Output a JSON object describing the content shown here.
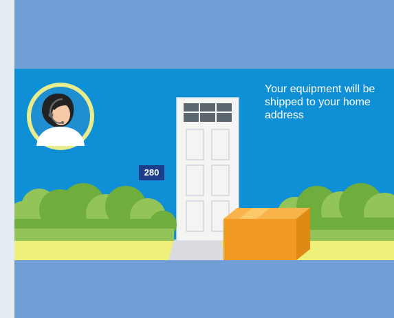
{
  "banner": {
    "caption": "Your equipment will be shipped to your home address",
    "house_number": "280"
  },
  "icons": {
    "agent": "support-agent-headset-icon",
    "door": "front-door-illustration",
    "package": "shipping-box-illustration",
    "bushes": "bush-illustration"
  },
  "colors": {
    "page_background": "#6f9fd4",
    "scene_sky": "#0f8fd6",
    "avatar_ring": "#e8ec8a",
    "house_number_plate": "#1b3d8c",
    "package": "#f4a02a",
    "bush_dark": "#6fae3c",
    "bush_light": "#93c45a",
    "ground": "#eef07a",
    "door": "#f4f4f2"
  }
}
